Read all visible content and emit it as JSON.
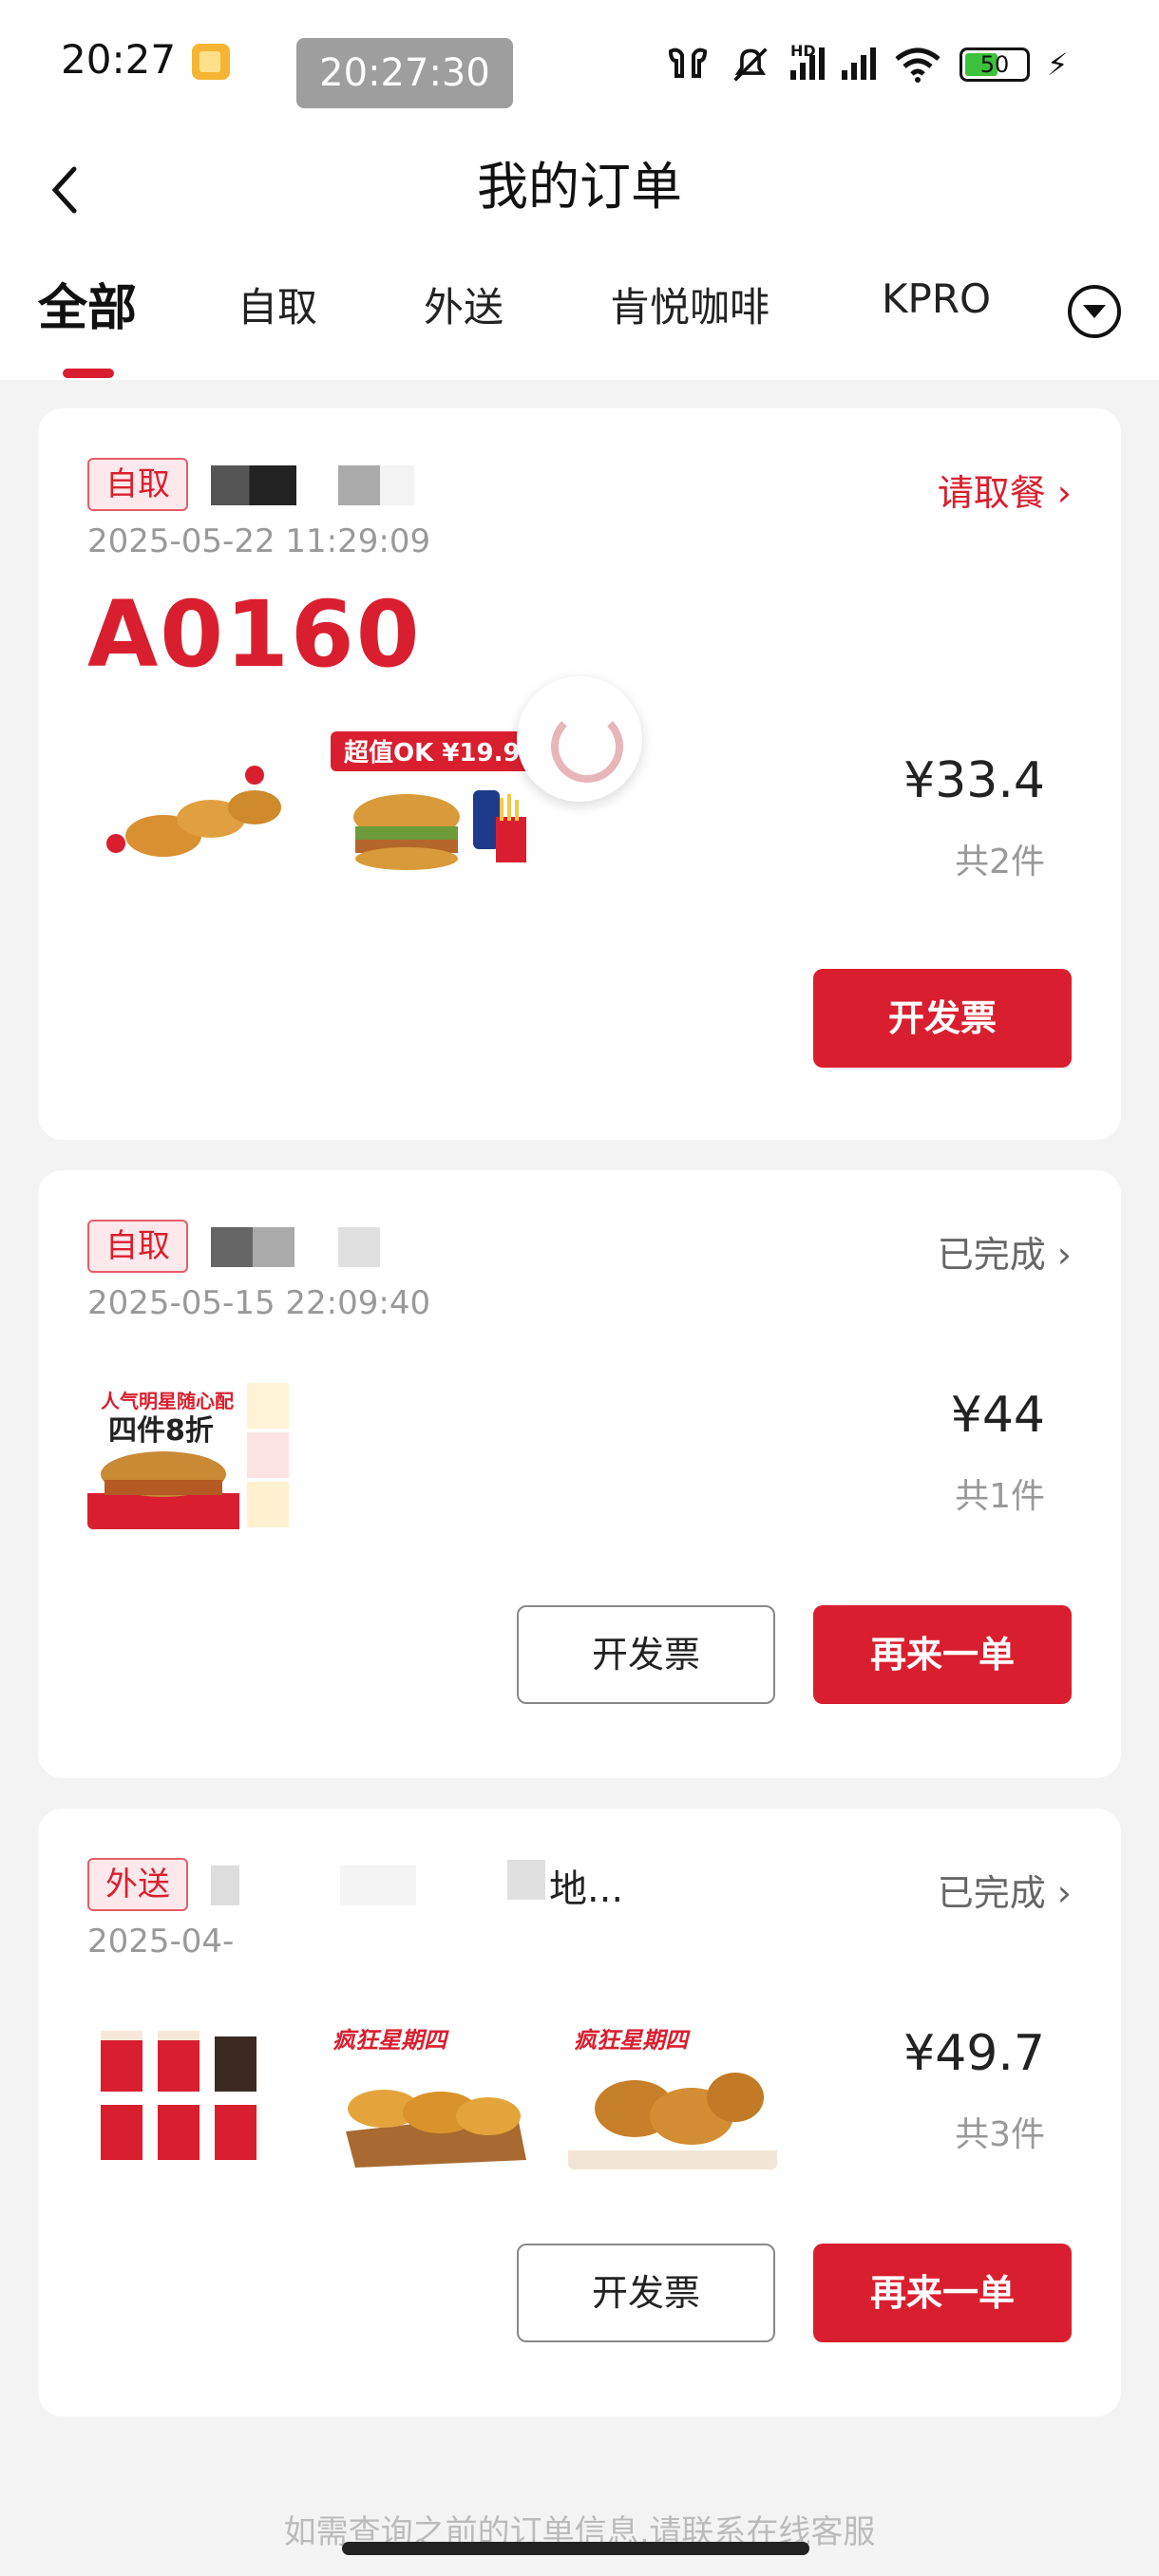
{
  "status_bar": {
    "time": "20:27",
    "clock_overlay": "20:27:30",
    "network": "HD",
    "battery": "50"
  },
  "header": {
    "title": "我的订单"
  },
  "tabs": [
    {
      "label": "全部",
      "active": true
    },
    {
      "label": "自取",
      "active": false
    },
    {
      "label": "外送",
      "active": false
    },
    {
      "label": "肯悦咖啡",
      "active": false
    },
    {
      "label": "KPRO",
      "active": false
    }
  ],
  "orders": [
    {
      "tag": "自取",
      "status": "请取餐",
      "datetime": "2025-05-22 11:29:09",
      "pickup_code": "A0160",
      "thumbs": [
        {
          "icon": "fried-chicken-image"
        },
        {
          "icon": "burger-combo-image",
          "badge": "超值OK ¥19.9"
        }
      ],
      "price": "¥33.4",
      "count": "共2件",
      "buttons": [
        {
          "label": "开发票",
          "style": "red"
        }
      ]
    },
    {
      "tag": "自取",
      "status": "已完成",
      "datetime": "2025-05-15 22:09:40",
      "thumbs": [
        {
          "icon": "burger-promo-image",
          "promo": "人气明星随心配 四件8折"
        }
      ],
      "price": "¥44",
      "count": "共1件",
      "buttons": [
        {
          "label": "开发票",
          "style": "outline"
        },
        {
          "label": "再来一单",
          "style": "red"
        }
      ]
    },
    {
      "tag": "外送",
      "status": "已完成",
      "address_fragment": "地...",
      "datetime": "2025-04-",
      "thumbs": [
        {
          "icon": "coffee-cups-image"
        },
        {
          "icon": "crispy-chicken-image",
          "promo": "疯狂星期四"
        },
        {
          "icon": "chicken-drumsticks-image",
          "promo": "疯狂星期四"
        }
      ],
      "price": "¥49.7",
      "count": "共3件",
      "buttons": [
        {
          "label": "开发票",
          "style": "outline"
        },
        {
          "label": "再来一单",
          "style": "red"
        }
      ]
    }
  ],
  "footer": {
    "text": "如需查询之前的订单信息,请联系在线客服"
  },
  "colors": {
    "brand_red": "#d91f2f",
    "tag_bg": "#fde9eb",
    "page_bg": "#f3f3f3"
  }
}
